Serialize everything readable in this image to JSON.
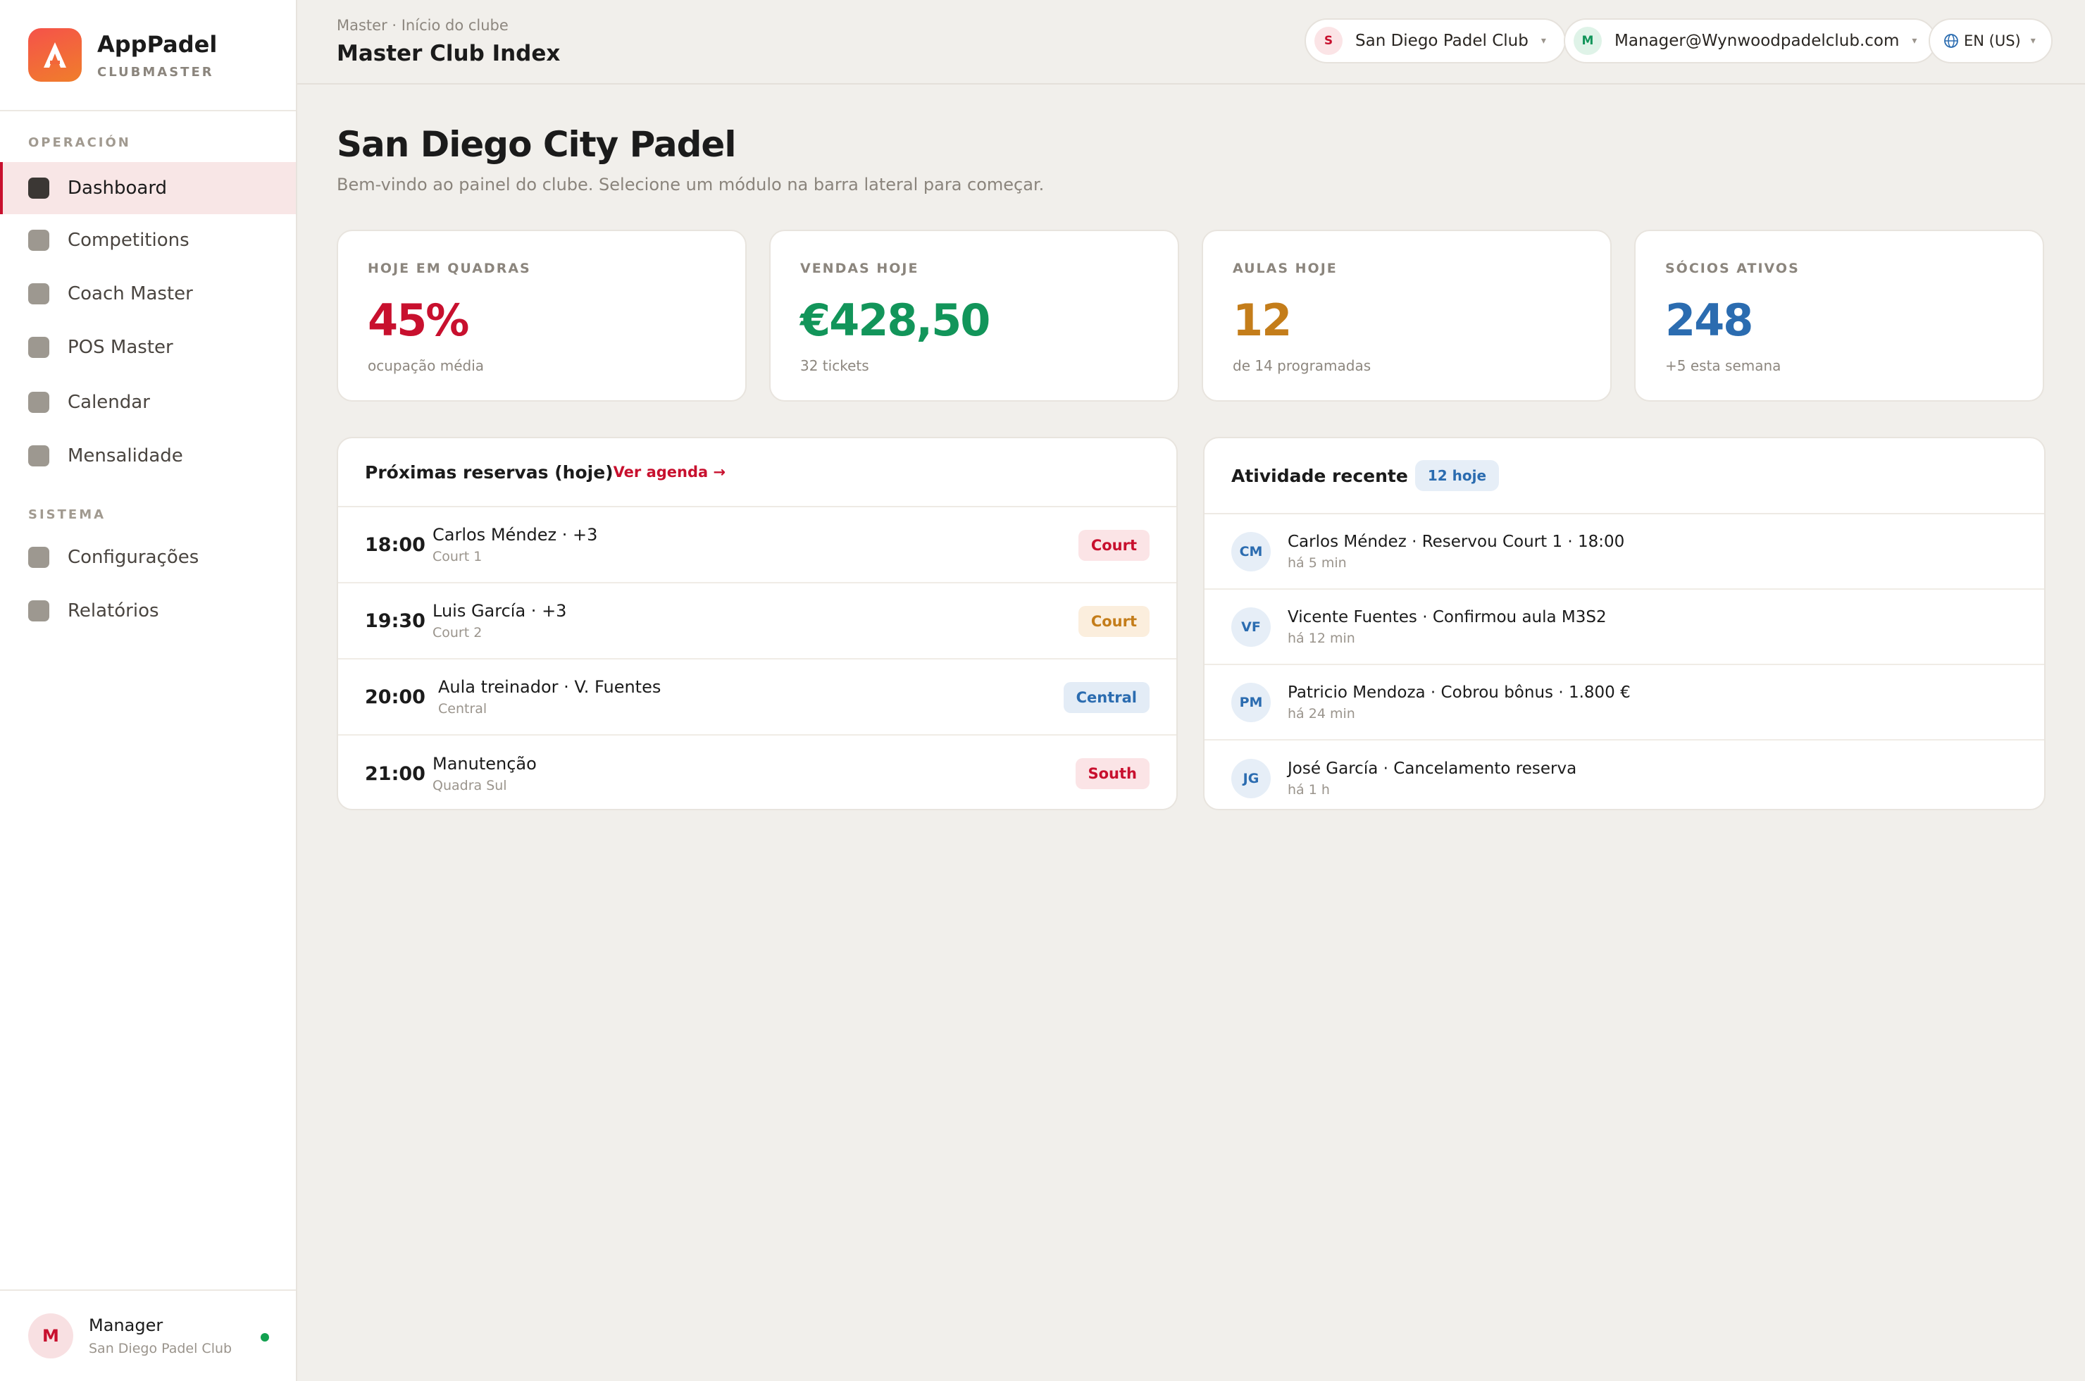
{
  "brand": {
    "name": "AppPadel",
    "sub": "CLUBMASTER"
  },
  "sidebar": {
    "section_operacao": "OPERACIÓN",
    "section_sistema": "SISTEMA",
    "items": [
      {
        "label": "Dashboard",
        "active": true
      },
      {
        "label": "Competitions"
      },
      {
        "label": "Coach Master"
      },
      {
        "label": "POS Master"
      },
      {
        "label": "Calendar"
      },
      {
        "label": "Mensalidade"
      },
      {
        "label": "Configurações"
      },
      {
        "label": "Relatórios"
      }
    ],
    "user": {
      "initial": "M",
      "name": "Manager",
      "club": "San Diego Padel Club",
      "status": "online"
    }
  },
  "topbar": {
    "breadcrumb": "Master · Início do clube",
    "title": "Master Club Index",
    "club_selector": {
      "initial": "S",
      "label": "San Diego Padel Club"
    },
    "account_selector": {
      "initial": "M",
      "label": "Manager@Wynwoodpadelclub.com"
    },
    "language_selector": {
      "label": "EN (US)"
    }
  },
  "page": {
    "title": "San Diego City Padel",
    "subtitle": "Bem-vindo ao painel do clube. Selecione um módulo na barra lateral para começar."
  },
  "stats": [
    {
      "label": "HOJE EM QUADRAS",
      "value": "45%",
      "sub": "ocupação média",
      "color": "#c8102e"
    },
    {
      "label": "VENDAS HOJE",
      "value": "€428,50",
      "sub": "32 tickets",
      "color": "#12955a"
    },
    {
      "label": "AULAS HOJE",
      "value": "12",
      "sub": "de 14 programadas",
      "color": "#c47d1a"
    },
    {
      "label": "SÓCIOS ATIVOS",
      "value": "248",
      "sub": "+5 esta semana",
      "color": "#2b6cb0"
    }
  ],
  "reservations": {
    "title": "Próximas reservas (hoje)",
    "link": "Ver agenda →",
    "rows": [
      {
        "time": "18:00",
        "name": "Carlos Méndez · +3",
        "place": "Court 1",
        "tag": "Court",
        "tag_bg": "#fbe4e6",
        "tag_fg": "#c8102e"
      },
      {
        "time": "19:30",
        "name": "Luis García · +3",
        "place": "Court 2",
        "tag": "Court",
        "tag_bg": "#fbeedd",
        "tag_fg": "#c47d1a"
      },
      {
        "time": "20:00",
        "name": "Aula treinador · V. Fuentes",
        "place": "Central",
        "tag": "Central",
        "tag_bg": "#e3ecf6",
        "tag_fg": "#2b6cb0"
      },
      {
        "time": "21:00",
        "name": "Manutenção",
        "place": "Quadra Sul",
        "tag": "South",
        "tag_bg": "#fbe4e6",
        "tag_fg": "#c8102e"
      }
    ]
  },
  "activity": {
    "title": "Atividade recente",
    "badge": "12 hoje",
    "rows": [
      {
        "initials": "CM",
        "text": "Carlos Méndez · Reservou Court 1 · 18:00",
        "time": "há 5 min"
      },
      {
        "initials": "VF",
        "text": "Vicente Fuentes · Confirmou aula M3S2",
        "time": "há 12 min"
      },
      {
        "initials": "PM",
        "text": "Patricio Mendoza · Cobrou bônus · 1.800 €",
        "time": "há 24 min"
      },
      {
        "initials": "JG",
        "text": "José García · Cancelamento reserva",
        "time": "há 1 h"
      }
    ]
  },
  "colors": {
    "accent": "#c8102e",
    "background": "#f1efeb",
    "card": "#ffffff"
  }
}
